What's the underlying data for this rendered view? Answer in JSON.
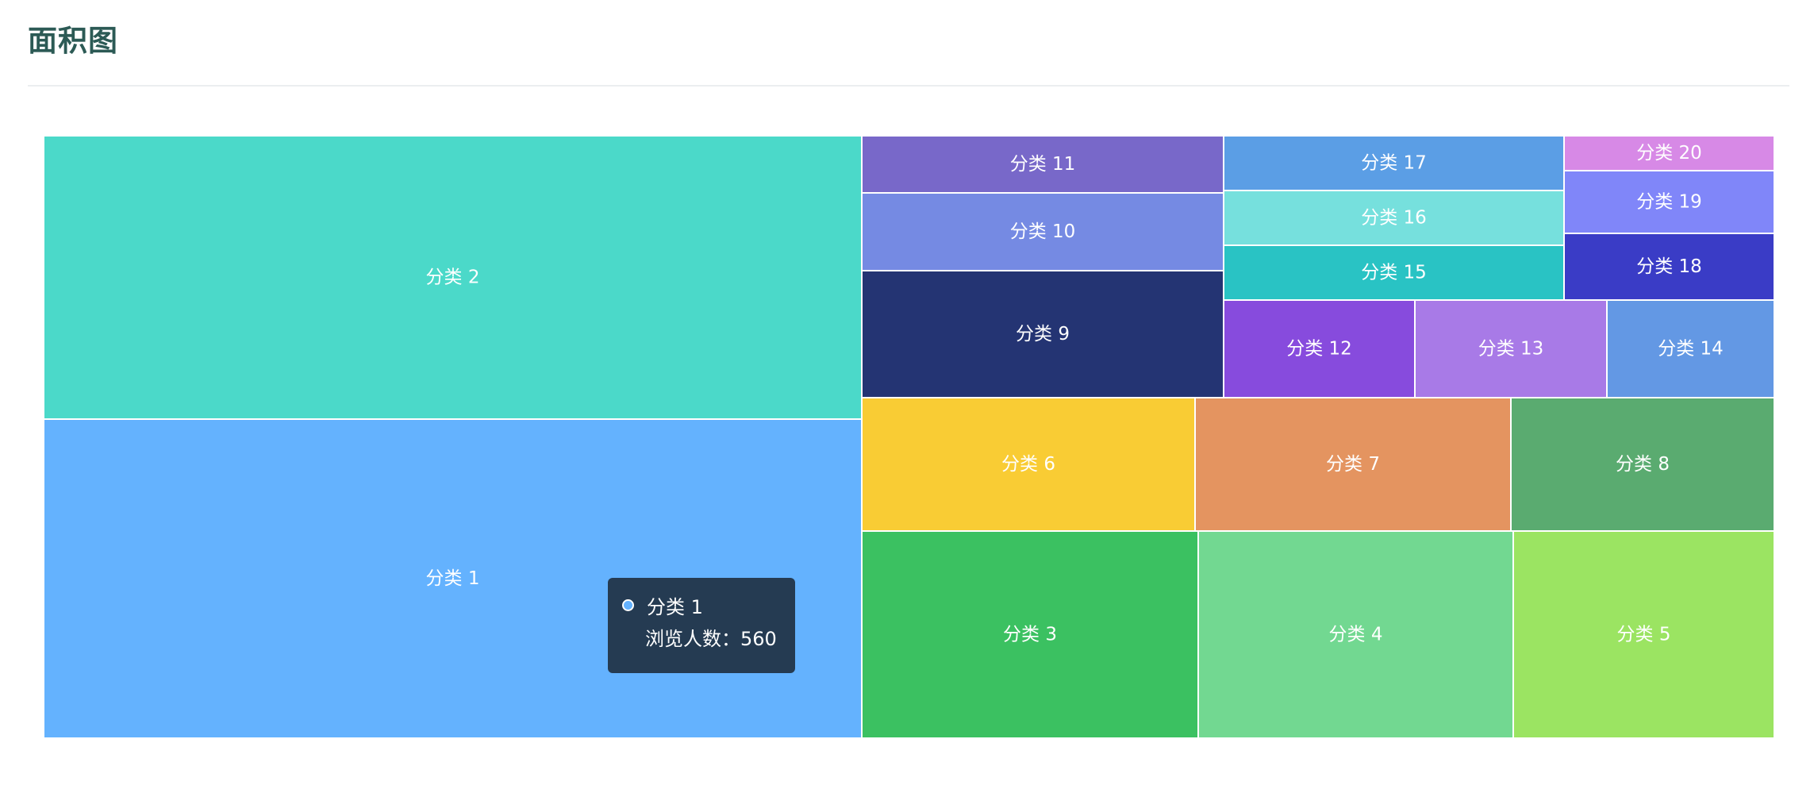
{
  "page": {
    "title": "面积图"
  },
  "chart_data": {
    "type": "treemap",
    "value_label": "浏览人数",
    "tiles": [
      {
        "name": "分类 1",
        "color": "#64b2fe"
      },
      {
        "name": "分类 2",
        "color": "#4bd9c9"
      },
      {
        "name": "分类 3",
        "color": "#3bc161"
      },
      {
        "name": "分类 4",
        "color": "#72d891"
      },
      {
        "name": "分类 5",
        "color": "#9be462"
      },
      {
        "name": "分类 6",
        "color": "#f9cc34"
      },
      {
        "name": "分类 7",
        "color": "#e49460"
      },
      {
        "name": "分类 8",
        "color": "#5aab70"
      },
      {
        "name": "分类 9",
        "color": "#243473"
      },
      {
        "name": "分类 10",
        "color": "#758ae3"
      },
      {
        "name": "分类 11",
        "color": "#7868c9"
      },
      {
        "name": "分类 12",
        "color": "#874bdd"
      },
      {
        "name": "分类 13",
        "color": "#a87ae7"
      },
      {
        "name": "分类 14",
        "color": "#6398e4"
      },
      {
        "name": "分类 15",
        "color": "#29c3c4"
      },
      {
        "name": "分类 16",
        "color": "#76e0dd"
      },
      {
        "name": "分类 17",
        "color": "#5b9ee5"
      },
      {
        "name": "分类 18",
        "color": "#3a3cc6"
      },
      {
        "name": "分类 19",
        "color": "#8086f9"
      },
      {
        "name": "分类 20",
        "color": "#d789e6"
      }
    ]
  },
  "tooltip": {
    "name": "分类 1",
    "value_text": "浏览人数：560",
    "marker_color": "#64b2fe"
  }
}
